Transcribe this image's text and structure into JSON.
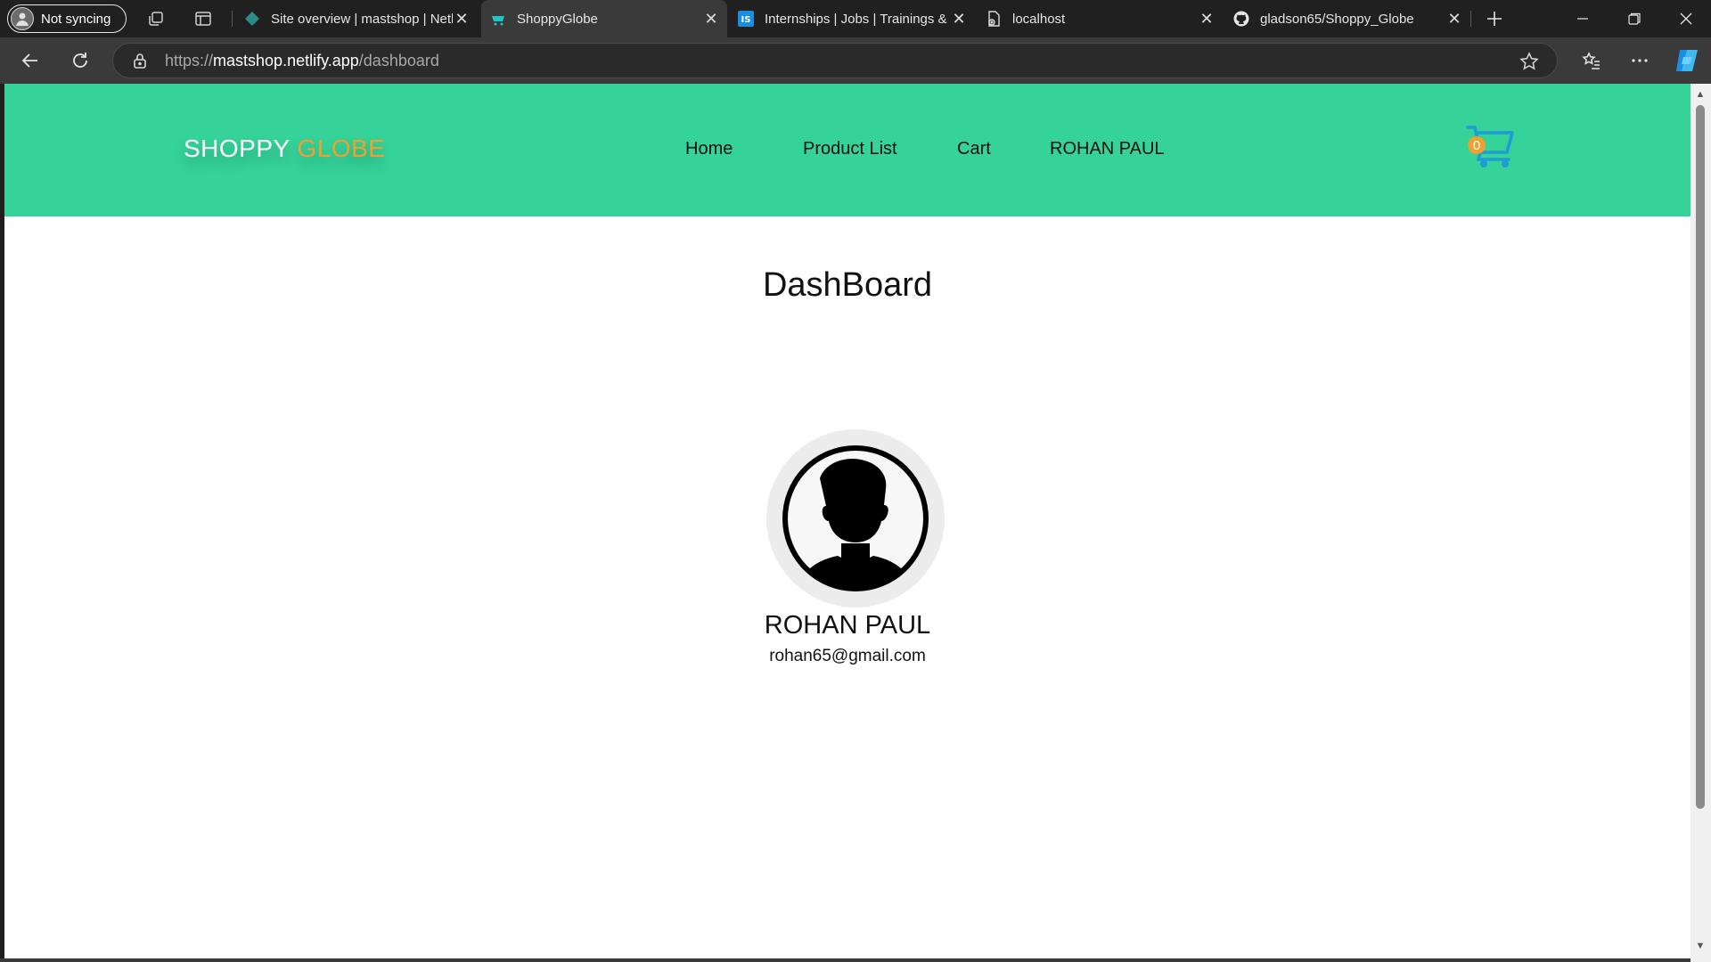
{
  "browser": {
    "profile_label": "Not syncing",
    "tabs": [
      {
        "title": "Site overview | mastshop | Netlify",
        "icon": "netlify-icon",
        "active": false
      },
      {
        "title": "ShoppyGlobe",
        "icon": "shoppyglobe-favicon",
        "active": true
      },
      {
        "title": "Internships | Jobs | Trainings & Courses",
        "icon": "internshala-icon",
        "active": false
      },
      {
        "title": "localhost",
        "icon": "broken-page-icon",
        "active": false
      },
      {
        "title": "gladson65/Shoppy_Globe",
        "icon": "github-icon",
        "active": false
      }
    ],
    "url_scheme": "https://",
    "url_host": "mastshop.netlify.app",
    "url_path": "/dashboard"
  },
  "site": {
    "brand_primary": "SHOPPY ",
    "brand_accent": "GLOBE",
    "nav": [
      "Home",
      "Product List",
      "Cart",
      "ROHAN PAUL"
    ],
    "cart_count": "0",
    "colors": {
      "navbar": "#35d399",
      "accent": "#f0a030",
      "cart": "#1f9bd6"
    }
  },
  "dashboard": {
    "title": "DashBoard",
    "user_name": "ROHAN PAUL",
    "user_email": "rohan65@gmail.com"
  }
}
